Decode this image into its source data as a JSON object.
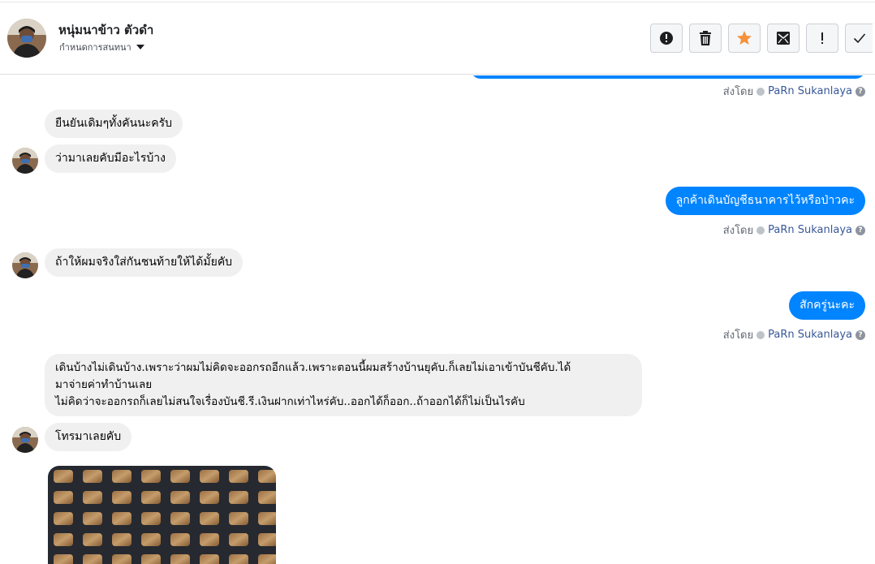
{
  "header": {
    "contact_name": "หนุ่มนาข้าว ตัวดำ",
    "settings_label": "กำหนดการสนทนา"
  },
  "toolbar": {
    "buttons": [
      {
        "icon": "alert-circle-icon"
      },
      {
        "icon": "trash-icon"
      },
      {
        "icon": "star-icon",
        "color": "#f7923b"
      },
      {
        "icon": "mark-unread-icon"
      },
      {
        "icon": "exclamation-icon"
      },
      {
        "icon": "check-icon"
      }
    ]
  },
  "thread": {
    "sent_by_label": "ส่งโดย",
    "sender_name": "PaRn Sukanlaya",
    "messages": [
      {
        "from": "contact",
        "text": "ยืนยันเดิมๆทั้งคันนะครับ"
      },
      {
        "from": "contact",
        "text": "ว่ามาเลยคับมีอะไรบ้าง"
      },
      {
        "from": "page",
        "text": "ลูกค้าเดินบัญชีธนาคารไว้หรือป่าวคะ"
      },
      {
        "from": "contact",
        "text": "ถ้าให้ผมจริงใส่กันชนท้ายให้ได้มั้ยคับ"
      },
      {
        "from": "page",
        "text": "สักครู่นะคะ"
      },
      {
        "from": "contact",
        "lines": [
          "เดินบ้างไม่เดินบ้าง.เพราะว่าผมไม่คิดจะออกรถอีกแล้ว.เพราะตอนนี้ผมสร้างบ้านยุคับ.ก็เลยไม่เอาเข้าบันชีคับ.ได้",
          "มาจ่ายค่าทำบ้านเลย",
          "ไม่คิดว่าจะออกรถก็เลยไม่สนใจเรื่องบันชี.รี.เงินฝากเท่าไหร่คับ..ออกได้ก็ออก..ถ้าออกได้ก็ไม่เป็นไรคับ"
        ]
      },
      {
        "from": "contact",
        "text": "โทรมาเลยคับ"
      }
    ]
  },
  "colors": {
    "outgoing_bubble": "#0084ff",
    "incoming_bubble": "#f0f0f0",
    "link_name": "#385898"
  }
}
